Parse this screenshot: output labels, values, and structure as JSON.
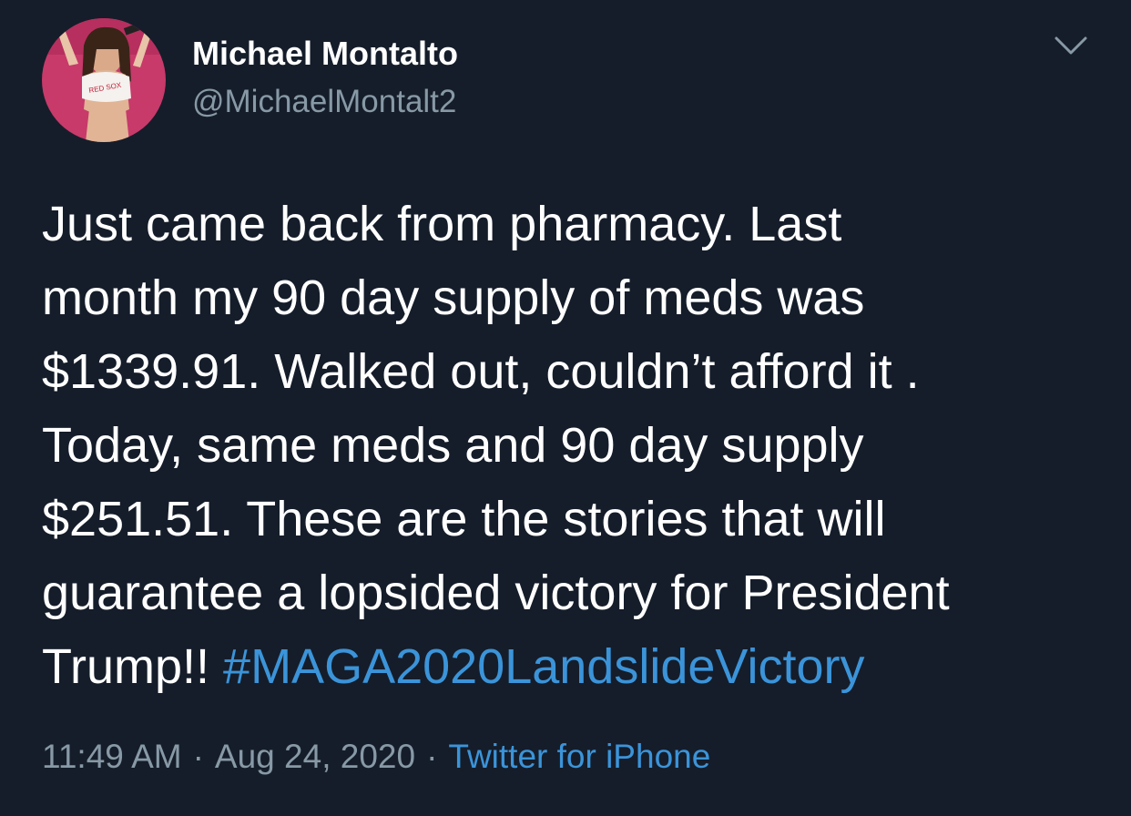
{
  "user": {
    "display_name": "Michael Montalto",
    "handle": "@MichaelMontalt2",
    "avatar_icon": "profile-photo"
  },
  "header": {
    "menu_icon": "chevron-down-icon"
  },
  "tweet": {
    "text_lines": "Just came back from pharmacy.  Last\nmonth my 90 day supply of meds was\n$1339.91. Walked out, couldn’t afford it .\nToday, same meds and 90 day supply\n$251.51. These are the stories that will\nguarantee a lopsided victory for President\nTrump!! ",
    "hashtag": "#MAGA2020LandslideVictory"
  },
  "meta": {
    "time": "11:49 AM",
    "separator1": "·",
    "date": "Aug 24, 2020",
    "separator2": "·",
    "source": "Twitter for iPhone"
  },
  "colors": {
    "background": "#151d2a",
    "text": "#ffffff",
    "secondary": "#8899a6",
    "link": "#3b94d9"
  }
}
